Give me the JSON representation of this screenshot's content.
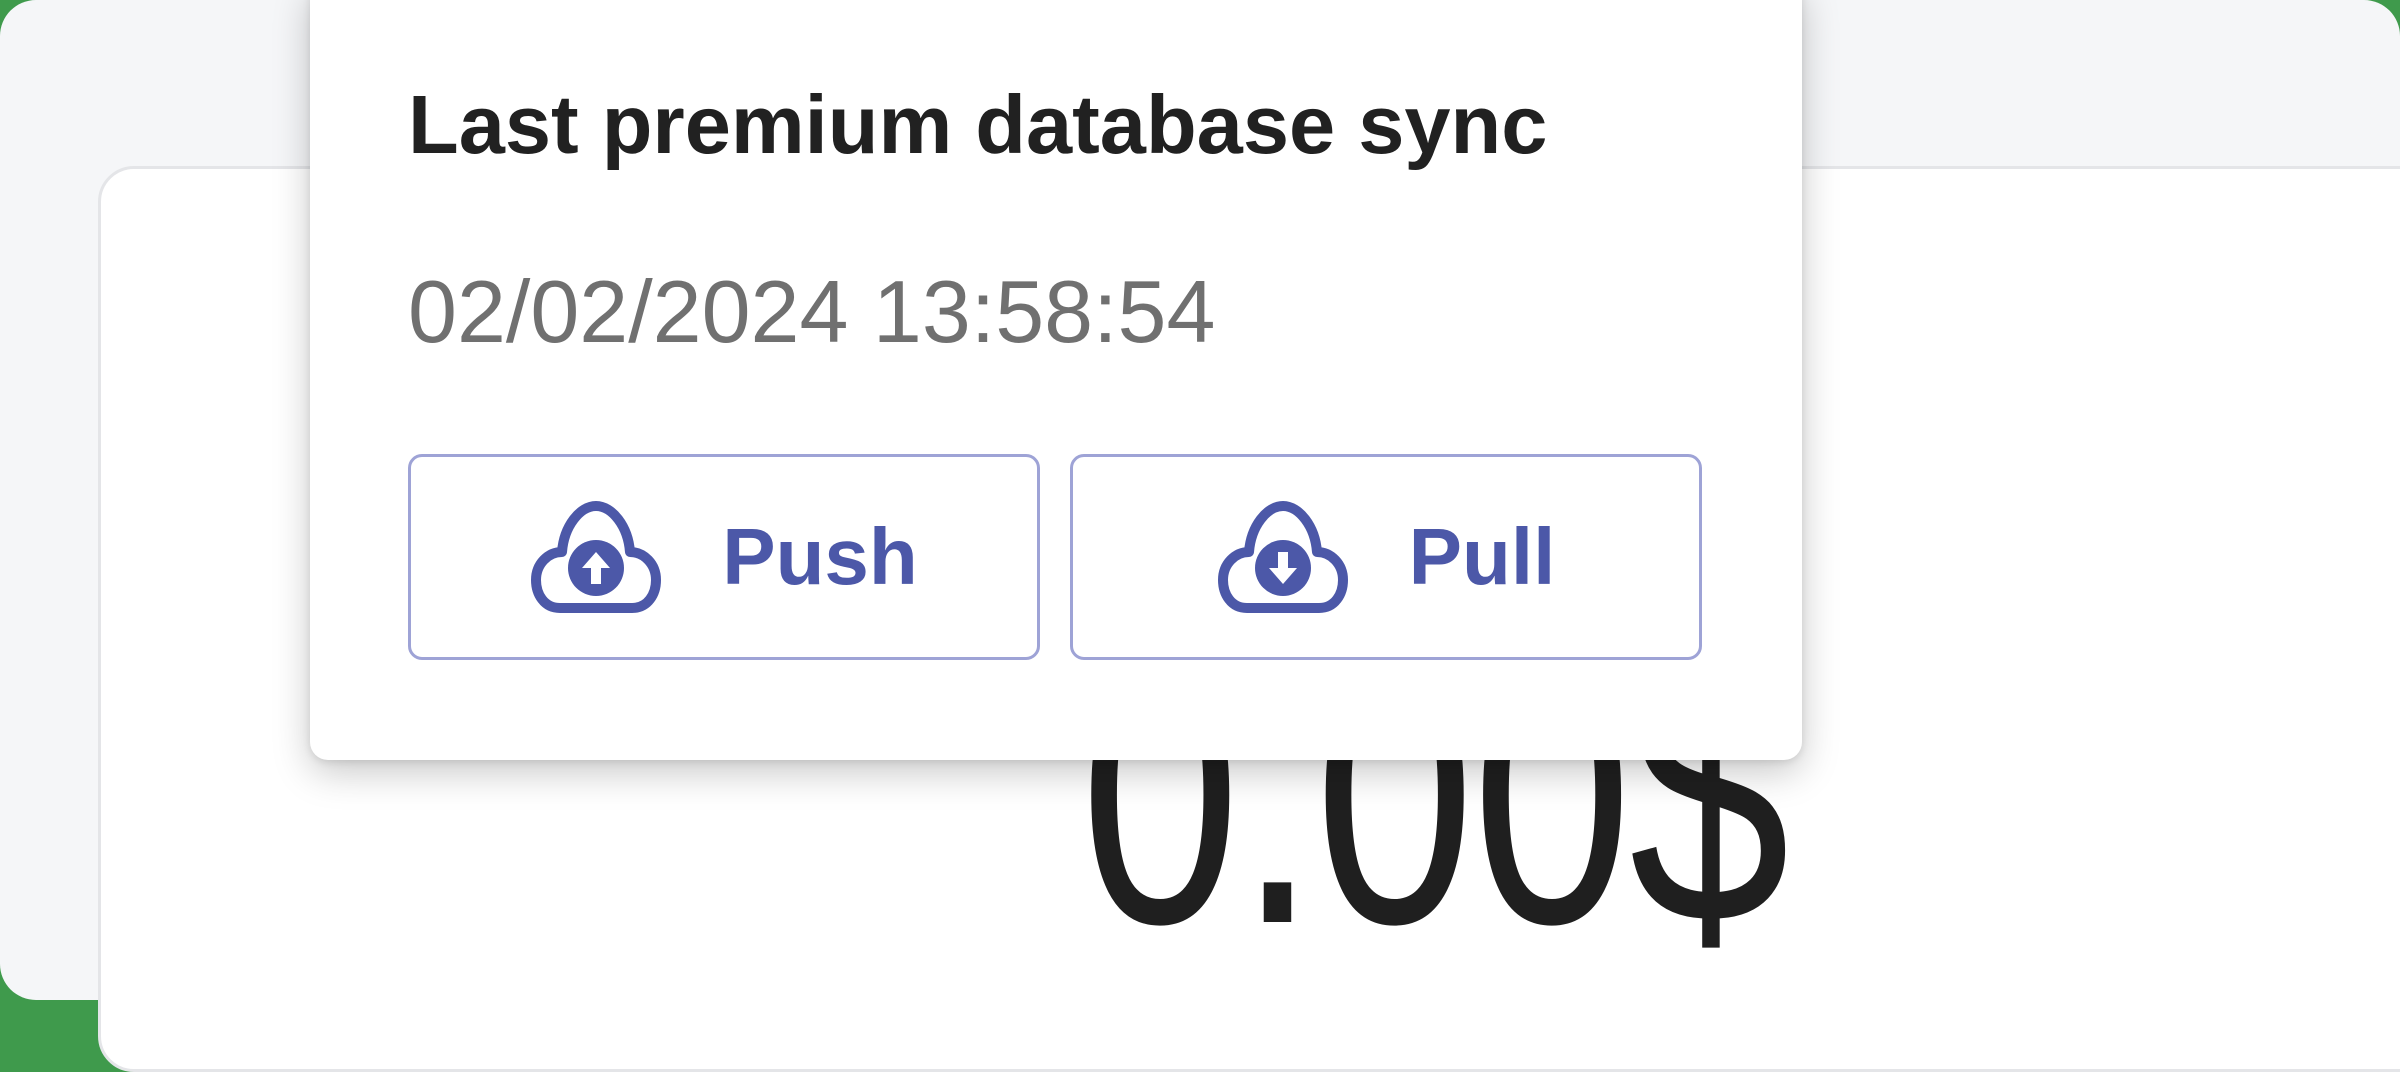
{
  "balance": {
    "value": "0.00$"
  },
  "sync_popover": {
    "title": "Last premium database sync",
    "timestamp": "02/02/2024 13:58:54",
    "push_button": {
      "label": "Push",
      "icon": "cloud-upload-icon"
    },
    "pull_button": {
      "label": "Pull",
      "icon": "cloud-download-icon"
    }
  },
  "colors": {
    "accent": "#4c58a8",
    "button_border": "#9ea3d6",
    "title_text": "#212121",
    "timestamp_text": "#707070",
    "frame_background": "#3f9a4c"
  }
}
